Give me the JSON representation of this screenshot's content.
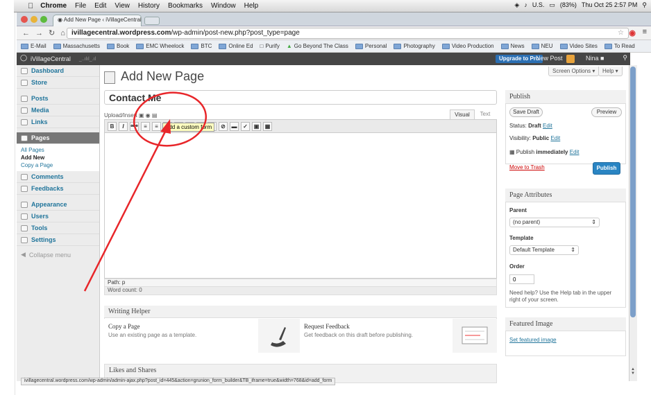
{
  "menubar": {
    "app": "Chrome",
    "items": [
      "File",
      "Edit",
      "View",
      "History",
      "Bookmarks",
      "Window",
      "Help"
    ],
    "battery": "(83%)",
    "input_lang": "U.S.",
    "clock": "Thu Oct 25  2:57 PM"
  },
  "browser": {
    "tab_title": "Add New Page ‹ iVillageCentral ×",
    "url_host": "ivillagecentral.wordpress.com",
    "url_path": "/wp-admin/post-new.php?post_type=page"
  },
  "bookmarks": [
    "E-Mail",
    "Massachusetts",
    "Book",
    "EMC Wheelock",
    "BTC",
    "Online Ed",
    "Purify",
    "Go Beyond The Class",
    "Personal",
    "Photography",
    "Video Production",
    "News",
    "NEU",
    "Video Sites",
    "To Read"
  ],
  "adminbar": {
    "site": "iVillageCentral",
    "upgrade": "Upgrade to Pro",
    "new_post": "New Post",
    "user": "Nina"
  },
  "sidebar": {
    "items_top": [
      "Dashboard",
      "Store"
    ],
    "items_mid": [
      "Posts",
      "Media",
      "Links"
    ],
    "active": "Pages",
    "subitems": [
      "All Pages",
      "Add New",
      "Copy a Page"
    ],
    "items_bot": [
      "Comments",
      "Feedbacks"
    ],
    "items_bot2": [
      "Appearance",
      "Users",
      "Tools",
      "Settings"
    ],
    "collapse": "Collapse menu"
  },
  "main": {
    "title": "Add New Page",
    "screen_options": "Screen Options ▾",
    "help": "Help ▾",
    "title_value": "Contact Me",
    "upload_label": "Upload/Insert",
    "tab_visual": "Visual",
    "tab_text": "Text",
    "tooltip": "Add a custom form",
    "path": "Path: p",
    "word_count": "Word count: 0"
  },
  "writing_helper": {
    "heading": "Writing Helper",
    "copy_title": "Copy a Page",
    "copy_desc": "Use an existing page as a template.",
    "feed_title": "Request Feedback",
    "feed_desc": "Get feedback on this draft before publishing."
  },
  "likes": {
    "heading": "Likes and Shares"
  },
  "publish": {
    "heading": "Publish",
    "save_draft": "Save Draft",
    "preview": "Preview",
    "status_label": "Status: ",
    "status_value": "Draft",
    "visibility_label": "Visibility: ",
    "visibility_value": "Public",
    "publish_label": "Publish ",
    "publish_value": "immediately",
    "edit": "Edit",
    "trash": "Move to Trash",
    "publish_btn": "Publish"
  },
  "attributes": {
    "heading": "Page Attributes",
    "parent_label": "Parent",
    "parent_value": "(no parent)",
    "template_label": "Template",
    "template_value": "Default Template",
    "order_label": "Order",
    "order_value": "0",
    "help": "Need help? Use the Help tab in the upper right of your screen."
  },
  "featured": {
    "heading": "Featured Image",
    "link": "Set featured image"
  },
  "status_url": "ivillagecentral.wordpress.com/wp-admin/admin-ajax.php?post_id=445&action=grunion_form_builder&TB_iframe=true&width=768&id=add_form",
  "colors": {
    "annotation": "#e8262a",
    "admin_bar": "#464646",
    "link": "#21759b",
    "publish_btn": "#2a85c3"
  }
}
